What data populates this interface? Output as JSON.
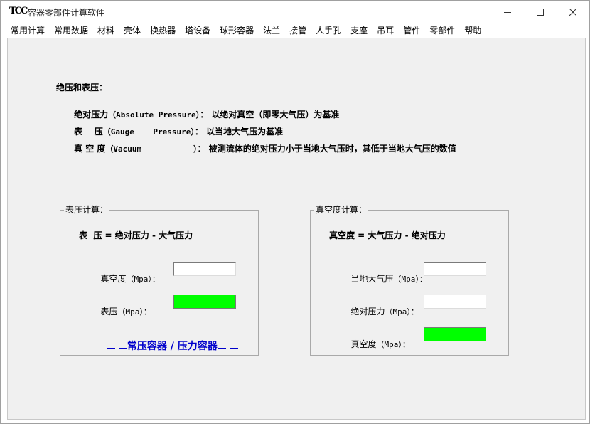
{
  "window": {
    "icon_text": "TCC",
    "title": "容器零部件计算软件",
    "controls": {
      "minimize": "minimize-icon",
      "maximize": "maximize-icon",
      "close": "close-icon"
    }
  },
  "menu": {
    "items": [
      "常用计算",
      "常用数据",
      "材料",
      "壳体",
      "换热器",
      "塔设备",
      "球形容器",
      "法兰",
      "接管",
      "人手孔",
      "支座",
      "吊耳",
      "管件",
      "零部件",
      "帮助"
    ]
  },
  "info": {
    "heading": "绝压和表压：",
    "absolute": {
      "name": "绝对压力",
      "en": "（Absolute Pressure）",
      "sep": "：",
      "desc": "以绝对真空（即零大气压）为基准"
    },
    "gauge": {
      "name": "表    压",
      "en": "（Gauge    Pressure）",
      "sep": "：",
      "desc": "以当地大气压为基准"
    },
    "vacuum": {
      "name": "真 空 度",
      "en": "（Vacuum           ）",
      "sep": "：",
      "desc": "被测流体的绝对压力小于当地大气压时，其低于当地大气压的数值"
    }
  },
  "gauge_group": {
    "title": "表压计算：",
    "formula": "表  压 = 绝对压力 - 大气压力",
    "vacuum_label": "真空度",
    "vacuum_unit": "（Mpa）：",
    "vacuum_value": "",
    "gauge_label": "表压",
    "gauge_unit": "（Mpa）：",
    "gauge_value": "",
    "link_text": "常压容器 / 压力容器"
  },
  "vacuum_group": {
    "title": "真空度计算：",
    "formula": "真空度 = 大气压力 - 绝对压力",
    "atm_label": "当地大气压",
    "atm_unit": "（Mpa）：",
    "atm_value": "",
    "abs_label": "绝对压力",
    "abs_unit": "（Mpa）：",
    "abs_value": "",
    "vac_label": "真空度",
    "vac_unit": "（Mpa）：",
    "vac_value": ""
  },
  "colors": {
    "result_bg": "#00ff00",
    "link": "#0000cc",
    "client_bg": "#f0f0f0"
  }
}
